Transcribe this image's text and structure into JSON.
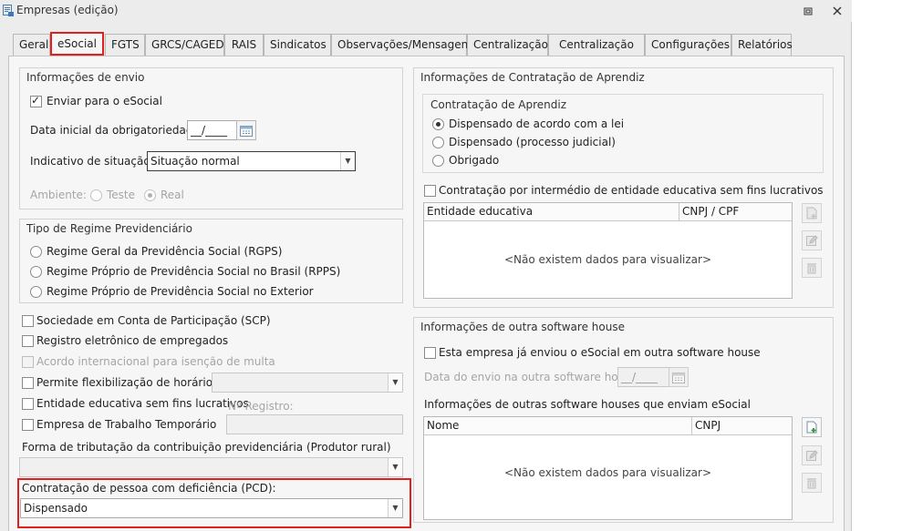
{
  "window": {
    "title": "Empresas (edição)"
  },
  "tabs": [
    "Geral",
    "eSocial",
    "FGTS",
    "GRCS/CAGED",
    "RAIS",
    "Sindicatos",
    "Observações/Mensagens",
    "Centralização",
    "Centralização CS",
    "Configurações",
    "Relatórios"
  ],
  "active_tab": "eSocial",
  "envio": {
    "title": "Informações de envio",
    "enviar_label": "Enviar para o eSocial",
    "enviar_checked": true,
    "data_label": "Data inicial da obrigatoriedade:",
    "data_value": "__/____",
    "indicativo_label": "Indicativo de situação:",
    "indicativo_value": "Situação normal",
    "ambiente_label": "Ambiente:",
    "ambiente_options": [
      "Teste",
      "Real"
    ],
    "ambiente_selected": "Real"
  },
  "regime": {
    "title": "Tipo de Regime Previdenciário",
    "options": [
      "Regime Geral da Previdência Social (RGPS)",
      "Regime Próprio de Previdência Social no Brasil (RPPS)",
      "Regime Próprio de Previdência Social no Exterior"
    ]
  },
  "checkboxes": {
    "scp": "Sociedade em Conta de Participação (SCP)",
    "registro": "Registro eletrônico de empregados",
    "acordo": "Acordo internacional para isenção de multa",
    "flexibilizacao": "Permite flexibilização de horários",
    "entidade": "Entidade educativa sem fins lucrativos",
    "nr_registro_label": "Nº Registro:",
    "temporario": "Empresa de Trabalho Temporário"
  },
  "tributacao": {
    "label": "Forma de tributação da contribuição previdenciária (Produtor rural)",
    "value": ""
  },
  "pcd": {
    "label": "Contratação de pessoa com deficiência (PCD):",
    "value": "Dispensado"
  },
  "aprendiz": {
    "title": "Informações de Contratação de Aprendiz",
    "sub_title": "Contratação de Aprendiz",
    "options": [
      "Dispensado de acordo com a lei",
      "Dispensado (processo judicial)",
      "Obrigado"
    ],
    "selected": "Dispensado de acordo com a lei",
    "intermedio_label": "Contratação por intermédio de entidade educativa sem fins lucrativos",
    "grid_columns": [
      "Entidade educativa",
      "CNPJ / CPF"
    ],
    "grid_empty": "<Não existem dados para visualizar>"
  },
  "software_house": {
    "title": "Informações de outra software house",
    "enviou_label": "Esta empresa já enviou o eSocial em outra software house",
    "data_label": "Data do envio na outra software house:",
    "data_value": "__/____",
    "list_label": "Informações de outras software houses que enviam eSocial",
    "grid_columns": [
      "Nome",
      "CNPJ"
    ],
    "grid_empty": "<Não existem dados para visualizar>"
  },
  "icons": {
    "add": "add-icon",
    "edit": "edit-icon",
    "delete": "trash-icon",
    "calendar": "calendar-icon",
    "restore": "restore-icon",
    "close": "close-icon"
  },
  "colors": {
    "highlight": "#e02020"
  }
}
